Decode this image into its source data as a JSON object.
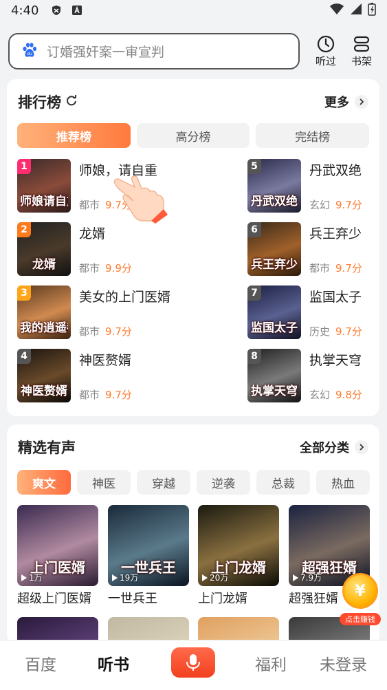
{
  "status_bar": {
    "time": "4:40"
  },
  "search": {
    "placeholder": "订婚强奸案一审宣判"
  },
  "top_actions": {
    "history_label": "听过",
    "bookshelf_label": "书架"
  },
  "ranking": {
    "title": "排行榜",
    "more_label": "更多",
    "tabs": [
      {
        "label": "推荐榜",
        "active": true
      },
      {
        "label": "高分榜",
        "active": false
      },
      {
        "label": "完结榜",
        "active": false
      }
    ],
    "books": [
      {
        "rank": "1",
        "title": "师娘，请自重",
        "genre": "都市",
        "score": "9.7分",
        "cover_text": "师娘请自重",
        "rank_color": "#ff2d6f"
      },
      {
        "rank": "2",
        "title": "龙婿",
        "genre": "都市",
        "score": "9.9分",
        "cover_text": "龙婿",
        "rank_color": "#ff7a1a"
      },
      {
        "rank": "3",
        "title": "美女的上门医婿",
        "genre": "都市",
        "score": "9.7分",
        "cover_text": "我的逍遥都市",
        "rank_color": "#ffa51a"
      },
      {
        "rank": "4",
        "title": "神医赘婿",
        "genre": "都市",
        "score": "9.7分",
        "cover_text": "神医赘婿",
        "rank_color": "#555555"
      },
      {
        "rank": "5",
        "title": "丹武双绝",
        "genre": "玄幻",
        "score": "9.7分",
        "cover_text": "丹武双绝",
        "rank_color": "#555555"
      },
      {
        "rank": "6",
        "title": "兵王弃少",
        "genre": "都市",
        "score": "9.7分",
        "cover_text": "兵王弃少",
        "rank_color": "#555555"
      },
      {
        "rank": "7",
        "title": "监国太子",
        "genre": "历史",
        "score": "9.7分",
        "cover_text": "监国太子",
        "rank_color": "#555555"
      },
      {
        "rank": "8",
        "title": "执掌天穹",
        "genre": "玄幻",
        "score": "9.8分",
        "cover_text": "执掌天穹",
        "rank_color": "#555555"
      }
    ]
  },
  "audio": {
    "title": "精选有声",
    "more_label": "全部分类",
    "tabs": [
      {
        "label": "爽文",
        "active": true
      },
      {
        "label": "神医",
        "active": false
      },
      {
        "label": "穿越",
        "active": false
      },
      {
        "label": "逆袭",
        "active": false
      },
      {
        "label": "总裁",
        "active": false
      },
      {
        "label": "热血",
        "active": false
      }
    ],
    "books": [
      {
        "title": "超级上门医婿",
        "plays": "1万",
        "cover_text": "上门医婿"
      },
      {
        "title": "一世兵王",
        "plays": "19万",
        "cover_text": "一世兵王"
      },
      {
        "title": "上门龙婿",
        "plays": "20万",
        "cover_text": "上门龙婿"
      },
      {
        "title": "超强狂婿",
        "plays": "7.9万",
        "cover_text": "超强狂婿"
      }
    ]
  },
  "reward": {
    "coin_symbol": "¥",
    "label": "点击赚钱"
  },
  "bottom_nav": {
    "home": "百度",
    "listen": "听书",
    "welfare": "福利",
    "account": "未登录"
  },
  "colors": {
    "accent": "#ff7a3d",
    "score": "#ff7a2e",
    "mic": "#f2401f"
  }
}
